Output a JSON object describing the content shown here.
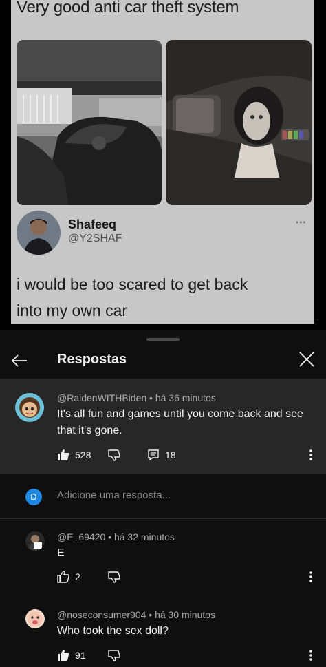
{
  "meme": {
    "title": "Very good anti car theft system",
    "profile_name": "Shafeeq",
    "profile_handle": "@Y2SHAF",
    "more_icon": "•••",
    "tweet_lines": [
      "i would be too scared to get back",
      "into my own car"
    ]
  },
  "sheet": {
    "title": "Respostas",
    "back_icon": "arrow-left-icon",
    "close_icon": "close-icon"
  },
  "root_comment": {
    "author": "@RaidenWITHBiden",
    "time": "há 36 minutos",
    "lines": [
      "It's all fun and games until you come back and see",
      "that it's gone."
    ],
    "likes": "528",
    "replies": "18"
  },
  "reply_box": {
    "avatar_letter": "D",
    "placeholder": "Adicione uma resposta..."
  },
  "replies": [
    {
      "author": "@E_69420",
      "time": "há 32 minutos",
      "text": "E",
      "likes": "2"
    },
    {
      "author": "@noseconsumer904",
      "time": "há 30 minutos",
      "text": "Who took the sex doll?",
      "likes": "91"
    }
  ],
  "colors": {
    "sheet_bg": "#0f0f0f",
    "highlight_bg": "#272727",
    "accent_avatar": "#1e88e5"
  }
}
